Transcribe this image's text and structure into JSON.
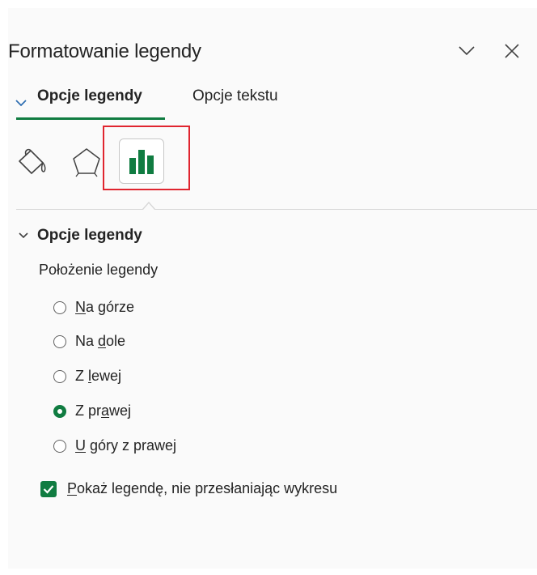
{
  "panel": {
    "title": "Formatowanie legendy",
    "icons": {
      "collapse": "chevron-down-icon",
      "close": "close-icon"
    }
  },
  "tabs": [
    {
      "label": "Opcje legendy",
      "active": true
    },
    {
      "label": "Opcje tekstu",
      "active": false
    }
  ],
  "icon_tabs": [
    {
      "name": "fill-line-icon",
      "selected": false
    },
    {
      "name": "effects-pentagon-icon",
      "selected": false
    },
    {
      "name": "legend-options-chart-icon",
      "selected": true
    }
  ],
  "section": {
    "title": "Opcje legendy",
    "group_label": "Położenie legendy",
    "positions": [
      {
        "pre": "",
        "acc": "N",
        "post": "a górze",
        "checked": false
      },
      {
        "pre": "Na ",
        "acc": "d",
        "post": "ole",
        "checked": false
      },
      {
        "pre": "Z ",
        "acc": "l",
        "post": "ewej",
        "checked": false
      },
      {
        "pre": "Z pr",
        "acc": "a",
        "post": "wej",
        "checked": true
      },
      {
        "pre": "",
        "acc": "U",
        "post": " góry z prawej",
        "checked": false
      }
    ],
    "overlay_checkbox": {
      "pre": "",
      "acc": "P",
      "post": "okaż legendę, nie przesłaniając wykresu",
      "checked": true
    }
  },
  "colors": {
    "accent": "#107c41",
    "highlight": "#e0252f"
  }
}
